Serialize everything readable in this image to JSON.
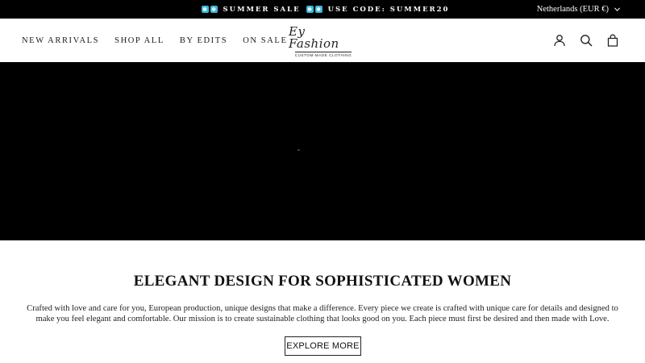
{
  "announcement": {
    "sale_text": "SUMMER SALE",
    "code_text": "USE CODE: SUMMER20",
    "icon": "snowflake-icon",
    "accent_color": "#3bb6d6"
  },
  "locale_selector": {
    "label": "Netherlands (EUR €)",
    "icon": "chevron-down-icon"
  },
  "nav": {
    "items": [
      {
        "label": "NEW ARRIVALS"
      },
      {
        "label": "SHOP ALL"
      },
      {
        "label": "BY EDITS"
      },
      {
        "label": "ON SALE"
      }
    ]
  },
  "logo": {
    "script": "Ey Fashion",
    "tagline": "CUSTOM-MADE CLOTHING"
  },
  "header_icons": [
    "account-icon",
    "search-icon",
    "cart-icon"
  ],
  "hero": {
    "background": "#000000"
  },
  "main": {
    "headline": "ELEGANT DESIGN FOR SOPHISTICATED WOMEN",
    "description": "Crafted with love and care for you, European production, unique designs that make a difference. Every piece we create is crafted with unique care for details and designed to make you feel elegant and comfortable. Our mission is to create sustainable clothing that looks good on you. Each piece must first be desired and then made with Love.",
    "cta_label": "EXPLORE MORE"
  }
}
